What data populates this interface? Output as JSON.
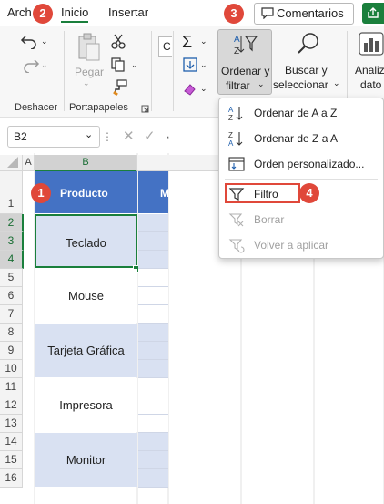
{
  "tabs": {
    "archivo": "Arch",
    "inicio": "Inicio",
    "insertar": "Insertar"
  },
  "badges": [
    "1",
    "2",
    "3",
    "4"
  ],
  "comments_label": "Comentarios",
  "ribbon": {
    "pegar": "Pegar",
    "ordenar_line1": "Ordenar y",
    "ordenar_line2": "filtrar",
    "buscar_line1": "Buscar y",
    "buscar_line2": "seleccionar",
    "analizar_line1": "Analiz",
    "analizar_line2": "dato",
    "group_deshacer": "Deshacer",
    "group_portapapeles": "Portapapeles",
    "font_partial": "C"
  },
  "formula_bar": {
    "name_box": "B2",
    "formula_value": ","
  },
  "columns": [
    "A",
    "B",
    "M"
  ],
  "rows": [
    "1",
    "2",
    "3",
    "4",
    "5",
    "6",
    "7",
    "8",
    "9",
    "10",
    "11",
    "12",
    "13",
    "14",
    "15",
    "16"
  ],
  "table": {
    "header": "Producto",
    "items": [
      "Teclado",
      "Mouse",
      "Tarjeta Gráfica",
      "Impresora",
      "Monitor"
    ]
  },
  "menu": {
    "items": [
      {
        "label": "Ordenar de A a Z",
        "enabled": true
      },
      {
        "label": "Ordenar de Z a A",
        "enabled": true
      },
      {
        "label": "Orden personalizado...",
        "enabled": true
      },
      {
        "label": "Filtro",
        "enabled": true
      },
      {
        "label": "Borrar",
        "enabled": false
      },
      {
        "label": "Volver a aplicar",
        "enabled": false
      }
    ]
  },
  "colors": {
    "accent_green": "#1a7f3c",
    "header_blue": "#4472c4",
    "band_blue": "#d9e1f2",
    "badge_red": "#e0483a",
    "highlight_red": "#e0483a"
  }
}
